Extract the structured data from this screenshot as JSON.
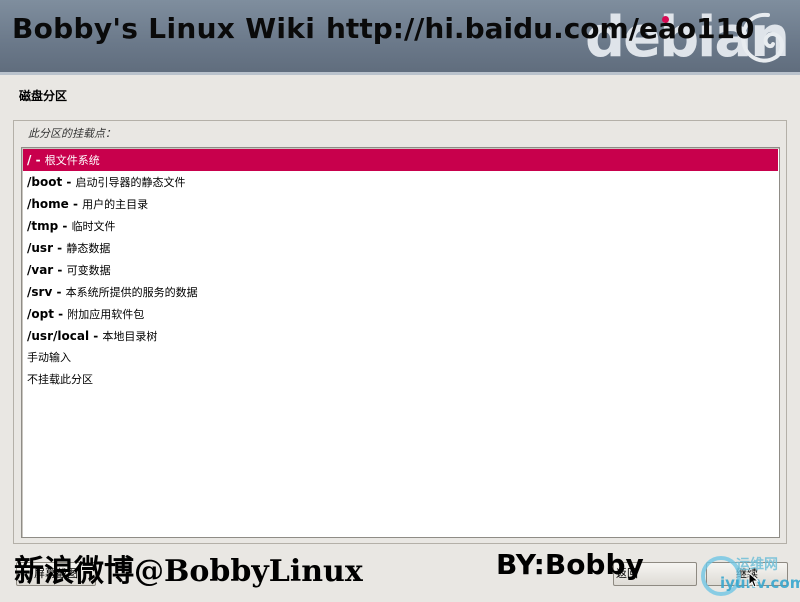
{
  "header": {
    "overlay_title": "Bobby's Linux Wiki",
    "overlay_url": "http://hi.baidu.com/eao110",
    "logo_text": "debian"
  },
  "section_title": "磁盘分区",
  "prompt": "此分区的挂载点：",
  "mount_points": [
    {
      "path": "/",
      "sep": " - ",
      "desc": "根文件系统",
      "selected": true
    },
    {
      "path": "/boot",
      "sep": " - ",
      "desc": "启动引导器的静态文件",
      "selected": false
    },
    {
      "path": "/home",
      "sep": " - ",
      "desc": "用户的主目录",
      "selected": false
    },
    {
      "path": "/tmp",
      "sep": " - ",
      "desc": "临时文件",
      "selected": false
    },
    {
      "path": "/usr",
      "sep": " - ",
      "desc": "静态数据",
      "selected": false
    },
    {
      "path": "/var",
      "sep": " - ",
      "desc": "可变数据",
      "selected": false
    },
    {
      "path": "/srv",
      "sep": " - ",
      "desc": "本系统所提供的服务的数据",
      "selected": false
    },
    {
      "path": "/opt",
      "sep": " - ",
      "desc": "附加应用软件包",
      "selected": false
    },
    {
      "path": "/usr/local",
      "sep": " - ",
      "desc": "本地目录树",
      "selected": false
    },
    {
      "path": "",
      "sep": "",
      "desc": "手动输入",
      "selected": false
    },
    {
      "path": "",
      "sep": "",
      "desc": "不挂载此分区",
      "selected": false
    }
  ],
  "footer": {
    "weibo": "新浪微博@BobbyLinux",
    "by": "BY:Bobby",
    "screenshot_label": "屏幕截图",
    "back_label": "返回",
    "continue_label": "继续",
    "watermark_1": "运维网",
    "watermark_2": "iyunv.com"
  },
  "colors": {
    "selection": "#c8004c",
    "debian_red": "#d70a53"
  }
}
